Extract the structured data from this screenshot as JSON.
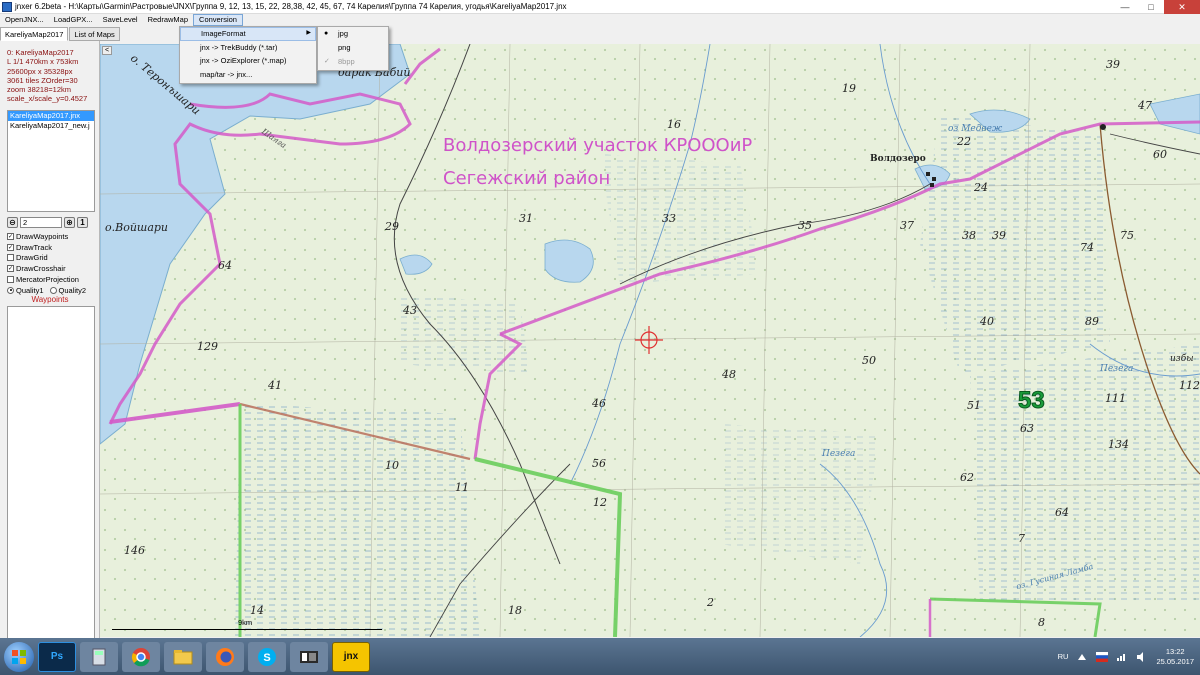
{
  "window": {
    "title": "jnxer 6.2beta - H:\\Карты\\Garmin\\Растровые\\JNX\\Группа 9, 12, 13, 15, 22, 28,38, 42, 45, 67, 74 Карелия\\Группа 74 Карелия, угодья\\KareliyaMap2017.jnx",
    "controls": {
      "minimize": "—",
      "maximize": "□",
      "close": "✕"
    }
  },
  "menubar": [
    "OpenJNX...",
    "LoadGPX...",
    "SaveLevel",
    "RedrawMap",
    "Conversion"
  ],
  "tabs": [
    "KareliyaMap2017",
    "List of Maps"
  ],
  "info": {
    "lines": [
      "0: KareliyaMap2017",
      "L 1/1  470km x 753km",
      "25600px x 35328px",
      "3061 tiles   ZOrder=30",
      "zoom 38218=12km",
      "scale_x/scale_y=0.4527"
    ]
  },
  "map_files": [
    "KareliyaMap2017.jnx",
    "KareliyaMap2017_new.j"
  ],
  "level": {
    "value": "2",
    "minus": "⊖",
    "plus": "⊕",
    "one": "1"
  },
  "checks": [
    {
      "label": "DrawWaypoints",
      "checked": true
    },
    {
      "label": "DrawTrack",
      "checked": true
    },
    {
      "label": "DrawGrid",
      "checked": false
    },
    {
      "label": "DrawCrosshair",
      "checked": true
    },
    {
      "label": "MercatorProjection",
      "checked": false
    }
  ],
  "quality": {
    "q1": "Quality1",
    "q2": "Quality2",
    "selected": "Quality1"
  },
  "waypoints_label": "Waypoints",
  "conversion_menu": {
    "items": [
      "ImageFormat",
      "jnx -> TrekBuddy (*.tar)",
      "jnx -> OziExplorer (*.map)",
      "map/tar -> jnx..."
    ],
    "submenu": [
      {
        "label": "jpg",
        "mark": "●"
      },
      {
        "label": "png",
        "mark": ""
      },
      {
        "label": "8bpp",
        "mark": "✓"
      }
    ]
  },
  "map": {
    "title_line1": "Волдозерский участок КРОООиР",
    "title_line2": "Сегежский район",
    "place_labels": {
      "teroshary": "о. Теронъшари",
      "voishari": "о.Войшари",
      "barak": "барак Бабий",
      "voldozero": "Волдозеро",
      "medvezh": "оз Медвеж",
      "pezega": "Пезега",
      "pezega2": "Пезега",
      "shalga": "Шалга",
      "izby": "избы",
      "gusinaya": "оз. Гусиная Ламба"
    },
    "numbers": [
      "39",
      "47",
      "60",
      "19",
      "16",
      "22",
      "24",
      "35",
      "37",
      "33",
      "31",
      "29",
      "38",
      "39",
      "74",
      "75",
      "64",
      "43",
      "40",
      "89",
      "129",
      "41",
      "50",
      "48",
      "46",
      "51",
      "63",
      "111",
      "112",
      "134",
      "10",
      "56",
      "11",
      "12",
      "62",
      "64",
      "146",
      "7",
      "18",
      "2",
      "14",
      "8",
      "53"
    ],
    "big_label": "53",
    "scale_text": "9km",
    "collapse_btn": "<"
  },
  "taskbar": {
    "lang": "RU",
    "time": "13:22",
    "date": "25.05.2017",
    "app_labels": [
      "Ps",
      "S",
      "jnx"
    ]
  }
}
